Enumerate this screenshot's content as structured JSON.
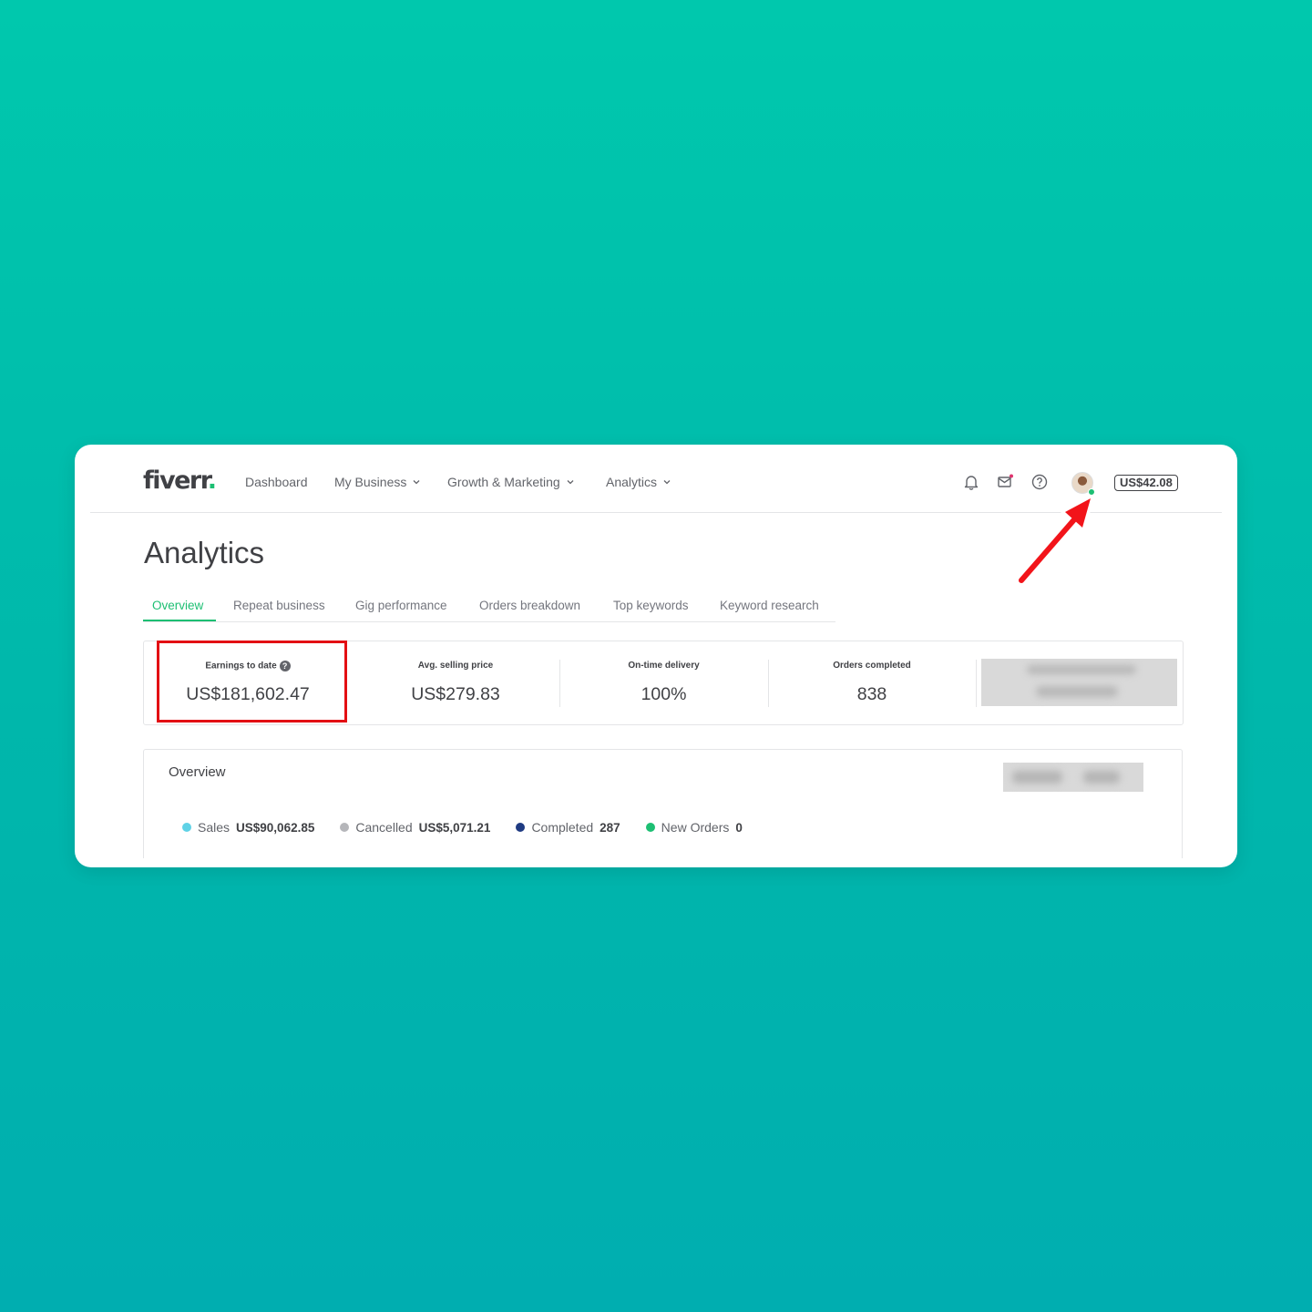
{
  "header": {
    "logo": "fiverr",
    "logo_dot": ".",
    "nav": [
      {
        "label": "Dashboard"
      },
      {
        "label": "My Business"
      },
      {
        "label": "Growth & Marketing"
      },
      {
        "label": "Analytics"
      }
    ],
    "icons": [
      "bell-icon",
      "mail-icon",
      "help-icon",
      "avatar"
    ],
    "balance": "US$42.08"
  },
  "page": {
    "title": "Analytics",
    "tabs": [
      {
        "label": "Overview",
        "active": true
      },
      {
        "label": "Repeat business"
      },
      {
        "label": "Gig performance"
      },
      {
        "label": "Orders breakdown"
      },
      {
        "label": "Top keywords"
      },
      {
        "label": "Keyword research"
      }
    ]
  },
  "stats": [
    {
      "label": "Earnings to date",
      "value": "US$181,602.47"
    },
    {
      "label": "Avg. selling price",
      "value": "US$279.83"
    },
    {
      "label": "On-time delivery",
      "value": "100%"
    },
    {
      "label": "Orders completed",
      "value": "838"
    }
  ],
  "overview": {
    "title": "Overview",
    "legend": [
      {
        "label": "Sales",
        "value": "US$90,062.85",
        "color": "#5fd2e6"
      },
      {
        "label": "Cancelled",
        "value": "US$5,071.21",
        "color": "#b5b6ba"
      },
      {
        "label": "Completed",
        "value": "287",
        "color": "#1f3b82"
      },
      {
        "label": "New Orders",
        "value": "0",
        "color": "#1dbf73"
      }
    ]
  },
  "colors": {
    "brand_green": "#1dbf73",
    "highlight_red": "#e30f13",
    "background_teal": "#00c2ad"
  }
}
